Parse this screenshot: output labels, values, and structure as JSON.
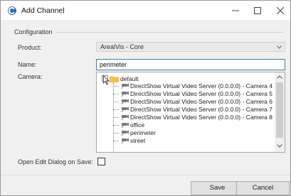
{
  "window": {
    "title": "Add Channel",
    "controls": {
      "minimize": "minimize",
      "maximize": "maximize",
      "close": "close"
    }
  },
  "config": {
    "group_label": "Configuration",
    "product_label": "Product:",
    "product_value": "ArealVis - Core",
    "name_label": "Name:",
    "name_value": "perimeter",
    "camera_label": "Camera:",
    "open_edit_label": "Open Edit Dialog on Save:"
  },
  "tree": {
    "root": "default",
    "items": [
      "DirectShow Virtual Video Server (0.0.0.0) - Camera 4",
      "DirectShow Virtual Video Server (0.0.0.0) - Camera 5",
      "DirectShow Virtual Video Server (0.0.0.0) - Camera 6",
      "DirectShow Virtual Video Server (0.0.0.0) - Camera 7",
      "DirectShow Virtual Video Server (0.0.0.0) - Camera 8",
      "office",
      "perimeter",
      "street"
    ]
  },
  "buttons": {
    "save": "Save",
    "cancel": "Cancel"
  },
  "colors": {
    "accent": "#3c7fb1",
    "folder": "#f5c542"
  },
  "icons": {
    "app": "app-logo-icon",
    "camera": "camera-icon",
    "folder": "folder-icon"
  }
}
